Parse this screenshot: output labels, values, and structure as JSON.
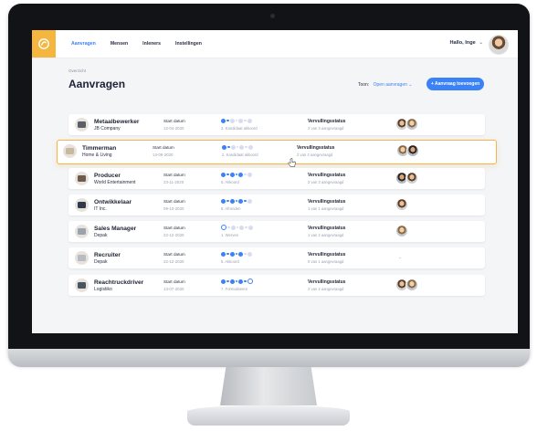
{
  "nav": {
    "items": [
      {
        "label": "Aanvragen",
        "active": true
      },
      {
        "label": "Mensen",
        "active": false
      },
      {
        "label": "Inleners",
        "active": false
      },
      {
        "label": "Instellingen",
        "active": false
      }
    ],
    "greeting": "Hallo, Inge",
    "greeting_caret": "⌄"
  },
  "page": {
    "breadcrumb": "Overzicht",
    "title": "Aanvragen",
    "filter_label": "Toon:",
    "filter_value": "Open aanvragen",
    "filter_caret": "⌄",
    "add_button": "+ Aanvraag toevoegen"
  },
  "columns": {
    "start_label": "Start datum",
    "status_label": "Vervullingsstatus"
  },
  "rows": [
    {
      "title": "Metaalbewerker",
      "company": "JB Company",
      "start": "12-04-2020",
      "step_label": "2. Kandidaat akkoord",
      "status": "2 van 3 aangevraagd",
      "steps_done": 2,
      "avatars": 2
    },
    {
      "title": "Timmerman",
      "company": "Home & Living",
      "start": "13-09-2020",
      "step_label": "2. Kandidaat akkoord",
      "status": "2 van 3 aangevraagd",
      "steps_done": 2,
      "avatars": 2
    },
    {
      "title": "Producer",
      "company": "World Entertainment",
      "start": "23-11-2020",
      "step_label": "5. Akkoord",
      "status": "2 van 3 aangevraagd",
      "steps_done": 5,
      "avatars": 2
    },
    {
      "title": "Ontwikkelaar",
      "company": "IT Inc.",
      "start": "09-10-2020",
      "step_label": "6. Afronden",
      "status": "1 van 1 aangevraagd",
      "steps_done": 6,
      "avatars": 1
    },
    {
      "title": "Sales Manager",
      "company": "Depak",
      "start": "22-12-2020",
      "step_label": "1. Werven",
      "status": "1 van 2 aangevraagd",
      "steps_done": 0,
      "avatars": 1
    },
    {
      "title": "Recruiter",
      "company": "Depak",
      "start": "22-12-2020",
      "step_label": "5. Akkoord",
      "status": "0 van 1 aangevraagd",
      "steps_done": 5,
      "avatars": 0
    },
    {
      "title": "Reachtruckdriver",
      "company": "Logistiko",
      "start": "13-07-2020",
      "step_label": "7. Formaliseren",
      "status": "2 van 2 aangevraagd",
      "steps_done": 6,
      "avatars": 2
    }
  ],
  "empty_avatar_text": "-",
  "icons": {
    "logo": "logo-icon",
    "cursor": "hand-cursor-icon"
  },
  "colors": {
    "accent": "#3b82f6",
    "brand": "#f5b640",
    "highlight_border": "#f1b54a"
  }
}
